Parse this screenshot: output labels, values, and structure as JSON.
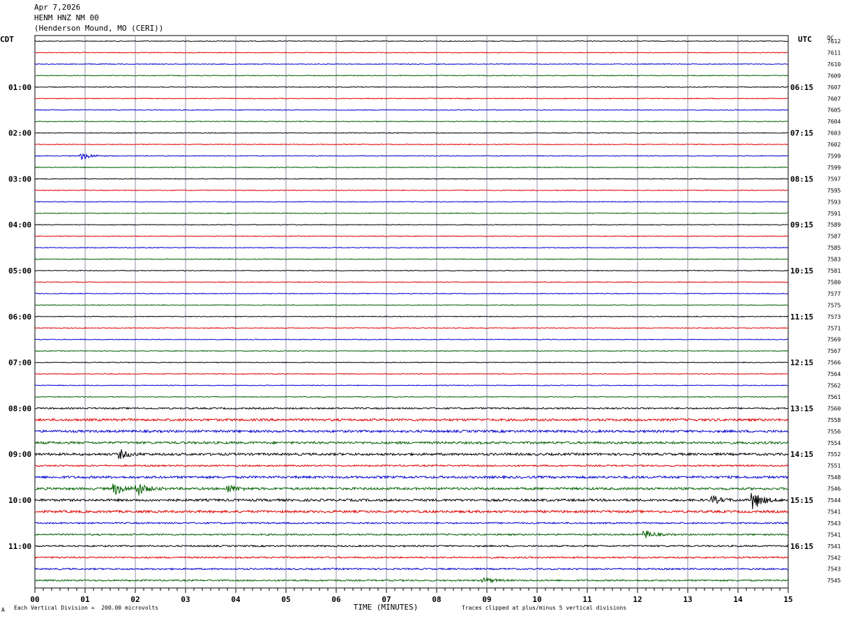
{
  "header": {
    "date": "Apr 7,2026",
    "channel": "HENM HNZ NM 00",
    "station": "(Henderson Mound, MO (CERI))"
  },
  "left_label": "CDT",
  "right_label": "UTC",
  "dc_label": "DC",
  "footer": {
    "scale_note": "Each Vertical Division =  200.00 microvolts",
    "clip_note": "Traces clipped at plus/minus 5 vertical divisions",
    "small_mark": "A"
  },
  "chart_data": {
    "type": "line",
    "title": "",
    "xlabel": "TIME (MINUTES)",
    "ylabel": "",
    "xlim": [
      0,
      15
    ],
    "x_ticks": [
      "00",
      "01",
      "02",
      "03",
      "04",
      "05",
      "06",
      "07",
      "08",
      "09",
      "10",
      "11",
      "12",
      "13",
      "14",
      "15"
    ],
    "grid": true,
    "trace_colors": [
      "#000000",
      "#e00000",
      "#0000d0",
      "#006000"
    ],
    "left_time_labels": [
      "01:00",
      "02:00",
      "03:00",
      "04:00",
      "05:00",
      "06:00",
      "07:00",
      "08:00",
      "09:00",
      "10:00",
      "11:00"
    ],
    "right_time_labels": [
      "06:15",
      "07:15",
      "08:15",
      "09:15",
      "10:15",
      "11:15",
      "12:15",
      "13:15",
      "14:15",
      "15:15",
      "16:15"
    ],
    "dc_offsets": [
      "7612",
      "7611",
      "7610",
      "7609",
      "7607",
      "7607",
      "7605",
      "7604",
      "7603",
      "7602",
      "7599",
      "7599",
      "7597",
      "7595",
      "7593",
      "7591",
      "7589",
      "7587",
      "7585",
      "7583",
      "7581",
      "7580",
      "7577",
      "7575",
      "7573",
      "7571",
      "7569",
      "7567",
      "7566",
      "7564",
      "7562",
      "7561",
      "7560",
      "7558",
      "7556",
      "7554",
      "7552",
      "7551",
      "7548",
      "7546",
      "7544",
      "7541",
      "7543",
      "7541",
      "7541",
      "7542",
      "7543",
      "7545"
    ],
    "trace_noise_levels": [
      1,
      1,
      1,
      1,
      1,
      1,
      1,
      1,
      1,
      1,
      1,
      1,
      1,
      1,
      1,
      1,
      1,
      1,
      1,
      1,
      1,
      1,
      1,
      1,
      1,
      1,
      1,
      1,
      1,
      1,
      1,
      1,
      2,
      3,
      3,
      3,
      3,
      2,
      3,
      3,
      3,
      3,
      2,
      2,
      2,
      2,
      2,
      2
    ],
    "events": [
      {
        "trace": 10,
        "minute": 0.95,
        "amplitude": 5
      },
      {
        "trace": 36,
        "minute": 1.7,
        "amplitude": 6
      },
      {
        "trace": 39,
        "minute": 1.6,
        "amplitude": 8
      },
      {
        "trace": 39,
        "minute": 2.05,
        "amplitude": 9
      },
      {
        "trace": 39,
        "minute": 3.85,
        "amplitude": 5
      },
      {
        "trace": 40,
        "minute": 14.3,
        "amplitude": 14
      },
      {
        "trace": 40,
        "minute": 13.5,
        "amplitude": 5
      },
      {
        "trace": 43,
        "minute": 12.15,
        "amplitude": 6
      },
      {
        "trace": 47,
        "minute": 8.95,
        "amplitude": 4
      }
    ]
  }
}
